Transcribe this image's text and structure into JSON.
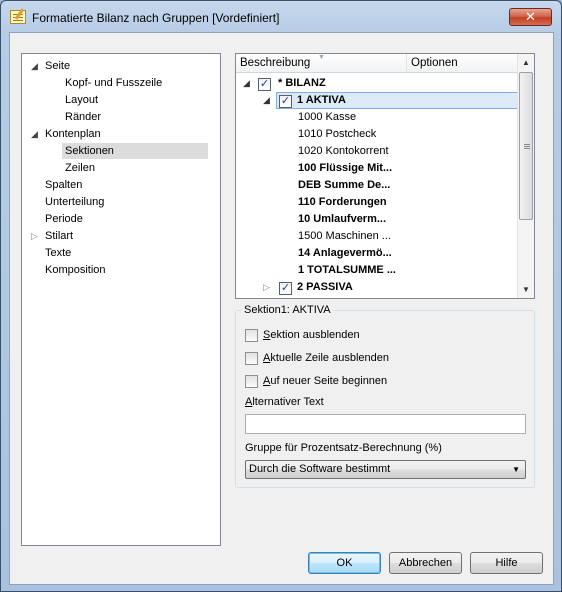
{
  "window": {
    "title": "Formatierte Bilanz nach Gruppen [Vordefiniert]",
    "close_glyph": "✕"
  },
  "nav_tree": {
    "items": [
      {
        "label": "Seite",
        "expander": "◢",
        "level": 0
      },
      {
        "label": "Kopf- und Fusszeile",
        "level": 1
      },
      {
        "label": "Layout",
        "level": 1
      },
      {
        "label": "Ränder",
        "level": 1
      },
      {
        "label": "Kontenplan",
        "expander": "◢",
        "level": 0
      },
      {
        "label": "Sektionen",
        "level": 1,
        "selected": true
      },
      {
        "label": "Zeilen",
        "level": 1
      },
      {
        "label": "Spalten",
        "level": 0
      },
      {
        "label": "Unterteilung",
        "level": 0
      },
      {
        "label": "Periode",
        "level": 0
      },
      {
        "label": "Stilart",
        "expander": "▷",
        "level": 0
      },
      {
        "label": "Texte",
        "level": 0
      },
      {
        "label": "Komposition",
        "level": 0
      }
    ]
  },
  "grid": {
    "columns": [
      "Beschreibung",
      "Optionen"
    ],
    "rows": [
      {
        "text": "* BILANZ",
        "bold": true,
        "checkbox": true,
        "checked": true,
        "expander": "◢"
      },
      {
        "text": "1 AKTIVA",
        "bold": true,
        "checkbox": true,
        "checked": true,
        "expander": "◢",
        "selected": true
      },
      {
        "text": "1000 Kasse",
        "bold": false
      },
      {
        "text": "1010 Postcheck",
        "bold": false
      },
      {
        "text": "1020 Kontokorrent",
        "bold": false
      },
      {
        "text": "100 Flüssige Mit...",
        "bold": true
      },
      {
        "text": "DEB Summe De...",
        "bold": true
      },
      {
        "text": "110 Forderungen",
        "bold": true
      },
      {
        "text": "10 Umlaufverm...",
        "bold": true
      },
      {
        "text": "1500 Maschinen ...",
        "bold": false
      },
      {
        "text": "14 Anlagevermö...",
        "bold": true
      },
      {
        "text": "1 TOTALSUMME ...",
        "bold": true
      },
      {
        "text": "2 PASSIVA",
        "bold": true,
        "checkbox": true,
        "checked": true,
        "expander": "▷"
      }
    ],
    "check_glyph": "✓"
  },
  "section": {
    "title": "Sektion1: AKTIVA",
    "checkboxes": [
      {
        "accel": "S",
        "rest": "ektion ausblenden",
        "checked": false
      },
      {
        "accel": "A",
        "rest": "ktuelle Zeile ausblenden",
        "checked": false
      },
      {
        "accel": "A",
        "rest": "uf neuer Seite beginnen",
        "checked": false
      }
    ],
    "alt_text_label_accel": "A",
    "alt_text_label_rest": "lternativer Text",
    "alt_text_value": "",
    "percent_group_label": "Gruppe für Prozentsatz-Berechnung (%)",
    "percent_group_value": "Durch die Software bestimmt"
  },
  "buttons": {
    "ok": "OK",
    "cancel": "Abbrechen",
    "help": "Hilfe"
  }
}
